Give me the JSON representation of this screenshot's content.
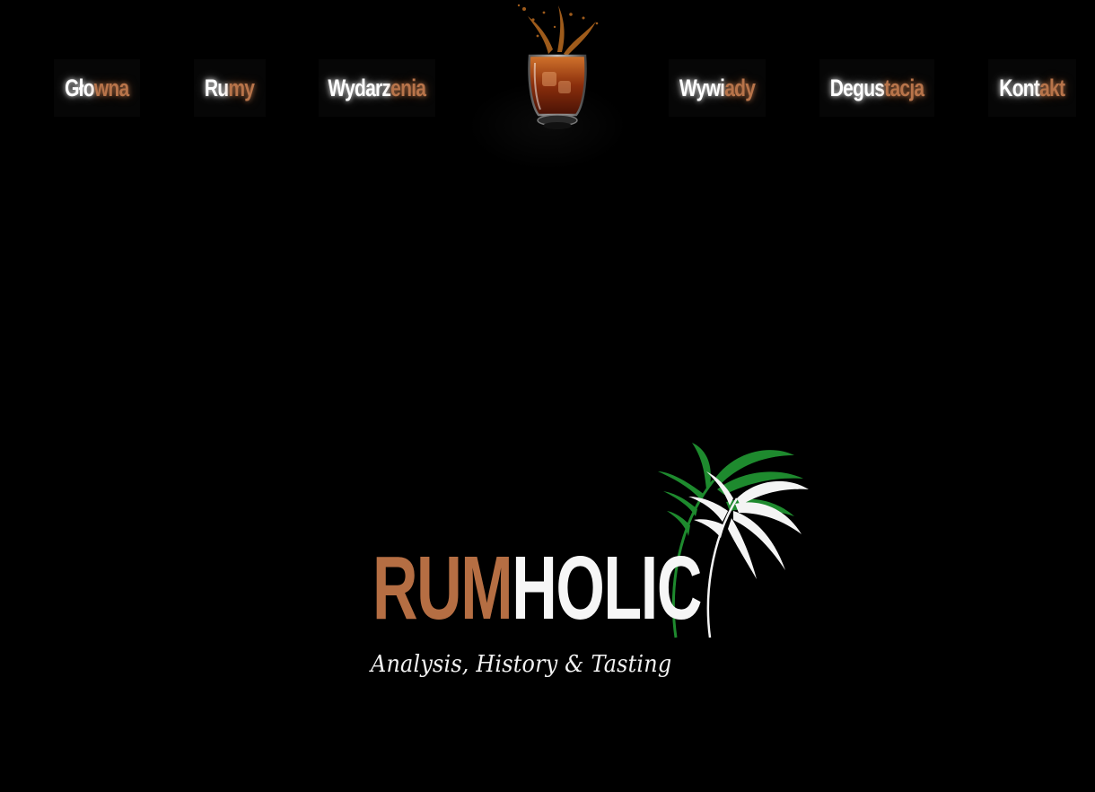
{
  "nav": {
    "items": [
      {
        "part_a": "Gło",
        "part_b": "wna"
      },
      {
        "part_a": "Ru",
        "part_b": "my"
      },
      {
        "part_a": "Wydarz",
        "part_b": "enia"
      },
      {
        "part_a": "Wywi",
        "part_b": "ady"
      },
      {
        "part_a": "Degus",
        "part_b": "tacja"
      },
      {
        "part_a": "Kont",
        "part_b": "akt"
      }
    ]
  },
  "logo": {
    "word_a": "RUM",
    "word_b": "HOLIC",
    "tagline": "Analysis, History & Tasting"
  },
  "colors": {
    "background": "#000000",
    "accent": "#b56e43",
    "text": "#ffffff",
    "palm_green": "#1e8a2e"
  },
  "icons": {
    "center": "rum-glass-splash-icon",
    "logo_mark": "palm-leaf-icon"
  }
}
